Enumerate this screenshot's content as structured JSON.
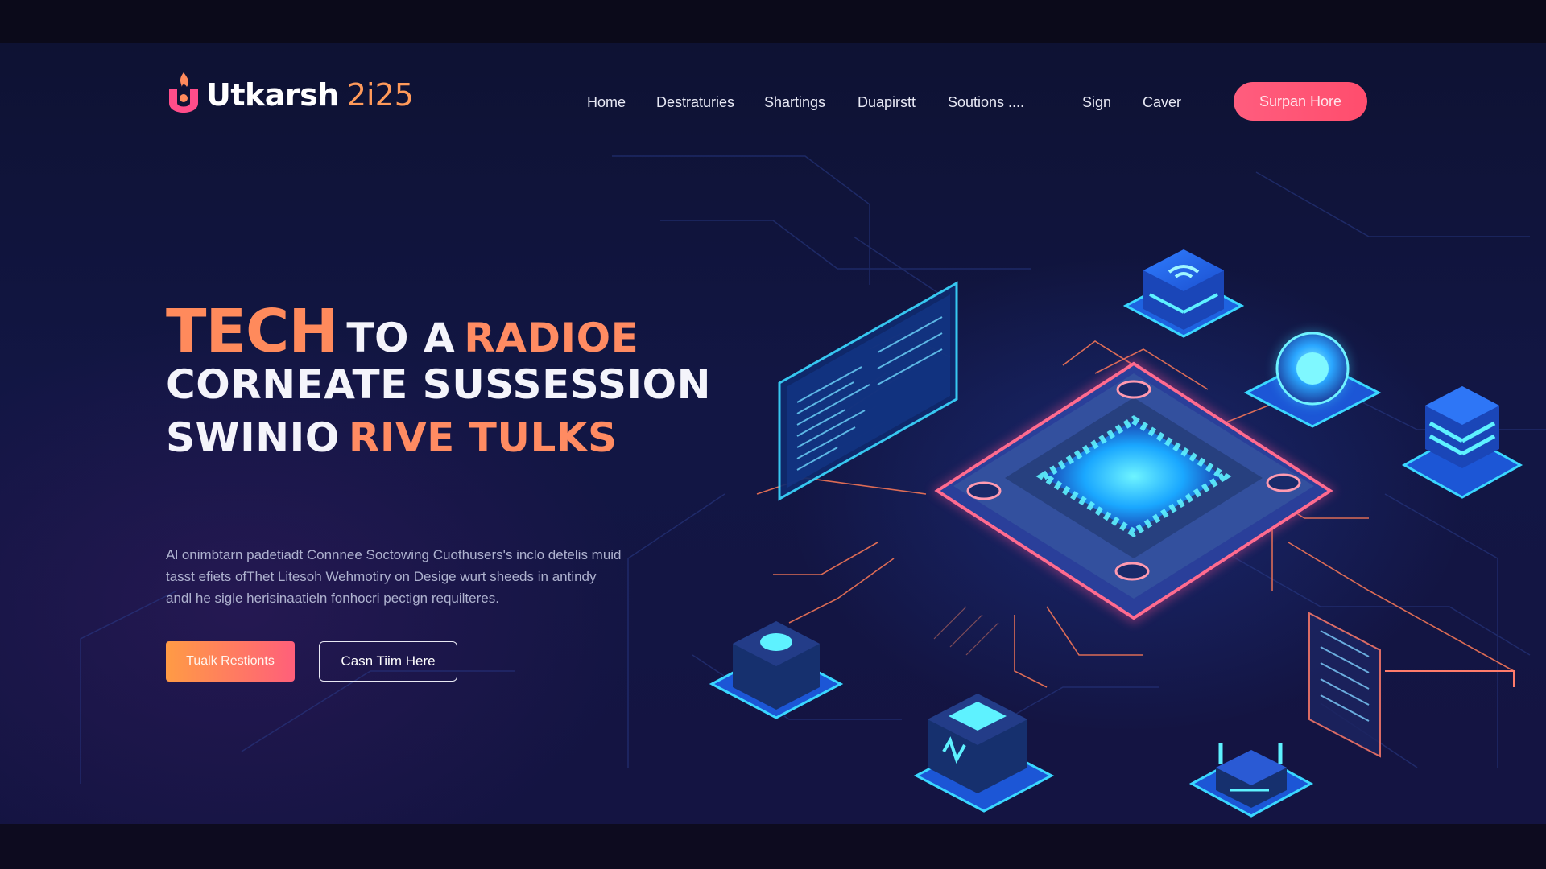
{
  "brand": {
    "name": "Utkarsh",
    "year": "2i25"
  },
  "nav": {
    "links": [
      "Home",
      "Destraturies",
      "Shartings",
      "Duapirstt",
      "Soutions ....",
      "Sign",
      "Caver"
    ],
    "cta": "Surpan Hore"
  },
  "hero": {
    "line1_big": "TECH",
    "line1_white": "TO A",
    "line1_orange": "RADIOE",
    "line2": "CORNEATE SUSSESSION",
    "line3_white": "SWINIO",
    "line3_orange": "RIVE TULKS",
    "description": [
      "Al onimbtarn padetiadt Connnee Soctowing Cuothusers's inclo detelis muid",
      "tasst efiets ofThet Litesoh Wehmotiry on Desige wurt sheeds in antindy",
      "andl he sigle herisinaatieln fonhocri pectign requilteres."
    ],
    "primary_button": "Tualk Restionts",
    "secondary_button": "Casn Tiim Here"
  },
  "colors": {
    "accent_orange": "#ff8a5c",
    "accent_pink": "#ff5d7e",
    "background": "#121644",
    "glow_cyan": "#37d5ff"
  }
}
